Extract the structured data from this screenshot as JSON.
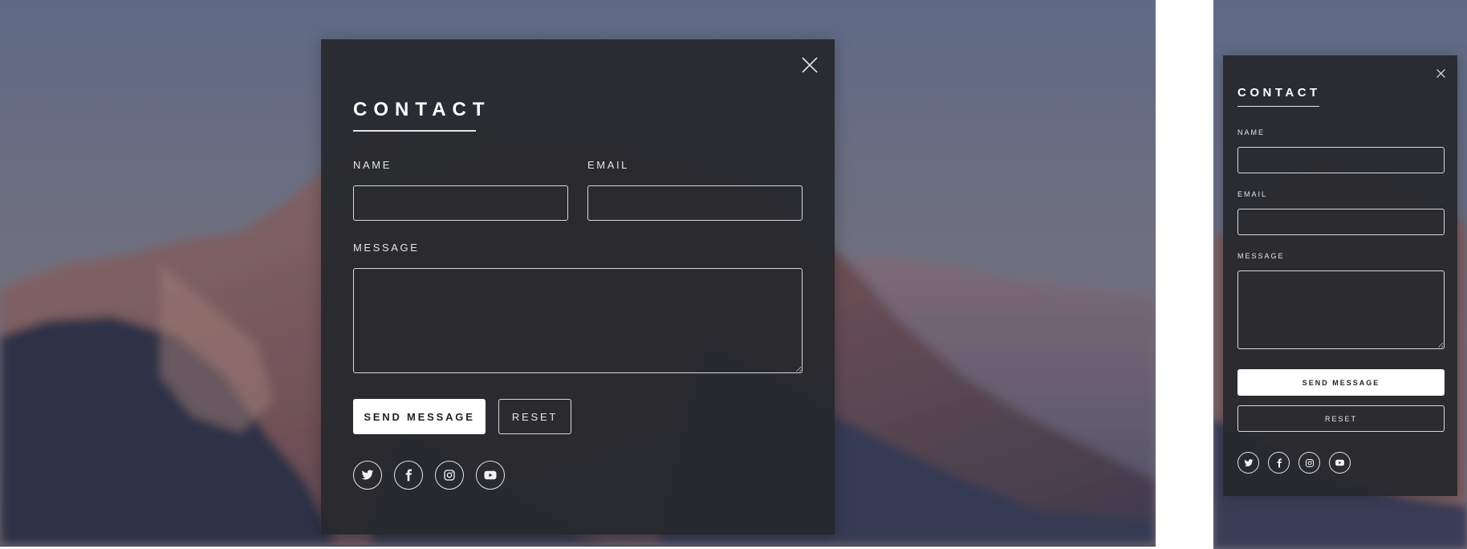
{
  "colors": {
    "modal_background": "#26282D",
    "text": "#E6E6E9",
    "button_primary_bg": "#FFFFFF",
    "button_primary_text": "#1F2126"
  },
  "desktop": {
    "title": "CONTACT",
    "name_label": "NAME",
    "name_value": "",
    "email_label": "EMAIL",
    "email_value": "",
    "message_label": "MESSAGE",
    "message_value": "",
    "send_label": "SEND MESSAGE",
    "reset_label": "RESET",
    "close_icon": "close-icon",
    "socials": [
      "twitter-icon",
      "facebook-icon",
      "instagram-icon",
      "youtube-icon"
    ]
  },
  "mobile": {
    "title": "CONTACT",
    "name_label": "NAME",
    "name_value": "",
    "email_label": "EMAIL",
    "email_value": "",
    "message_label": "MESSAGE",
    "message_value": "",
    "send_label": "SEND MESSAGE",
    "reset_label": "RESET",
    "close_icon": "close-icon",
    "socials": [
      "twitter-icon",
      "facebook-icon",
      "instagram-icon",
      "youtube-icon"
    ]
  }
}
